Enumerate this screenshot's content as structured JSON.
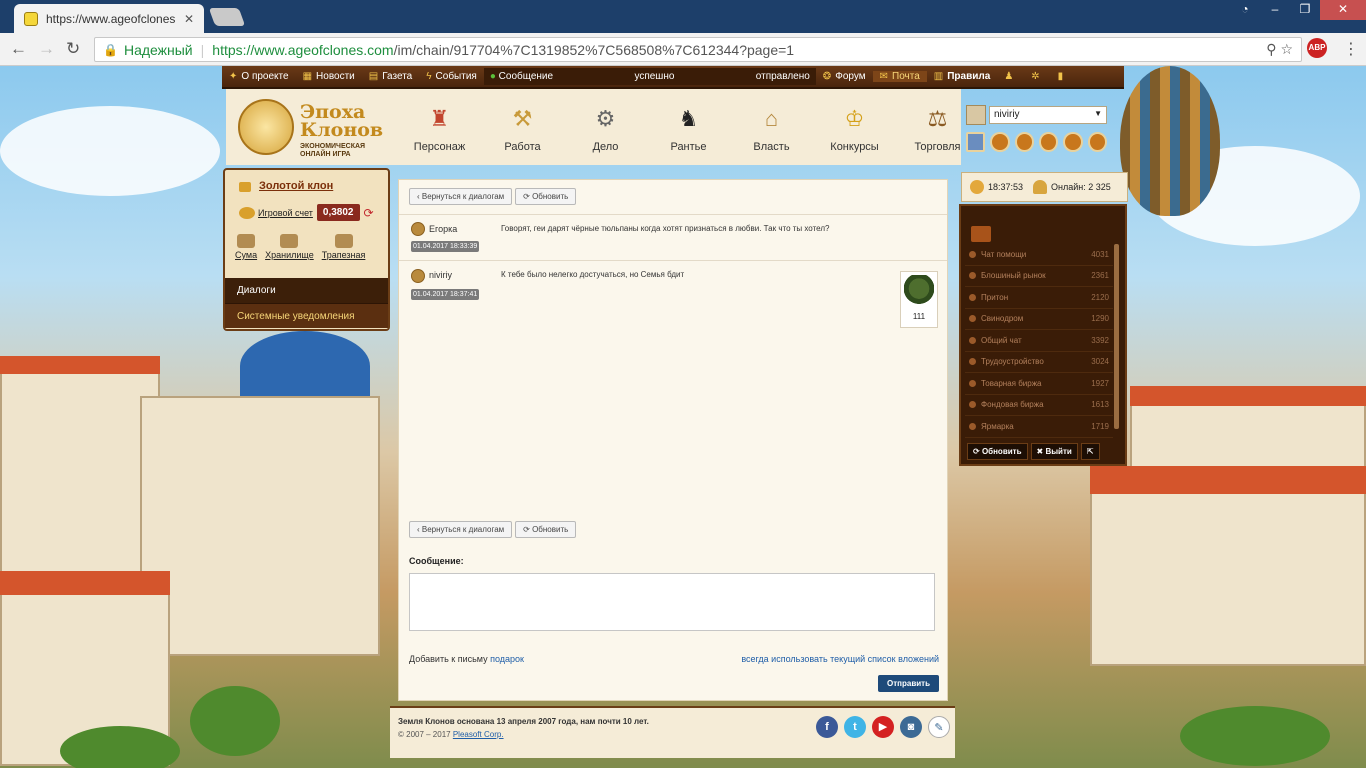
{
  "browser": {
    "tab_title": "https://www.ageofclones",
    "tab_close": "✕",
    "secure_label": "Надежный",
    "url_host": "https://www.ageofclones.com",
    "url_path": "/im/chain/917704%7C1319852%7C568508%7C612344?page=1",
    "abp": "ABP"
  },
  "gamebar": {
    "items": [
      {
        "label": "О проекте",
        "icon": "leaf-icon"
      },
      {
        "label": "Новости",
        "icon": "news-icon"
      },
      {
        "label": "Газета",
        "icon": "newspaper-icon"
      },
      {
        "label": "События",
        "icon": "bolt-icon"
      }
    ],
    "message_label": "Сообщение",
    "message_status1": "успешно",
    "message_status2": "отправлено",
    "forum": "Форум",
    "mail": "Почта",
    "rules": "Правила"
  },
  "logo": {
    "title1": "Эпоха",
    "title2": "Клонов",
    "subtitle": "ЭКОНОМИЧЕСКАЯ ОНЛАЙН ИГРА"
  },
  "mainnav": [
    {
      "label": "Персонаж",
      "icon": "character-icon"
    },
    {
      "label": "Работа",
      "icon": "work-icon"
    },
    {
      "label": "Дело",
      "icon": "business-icon"
    },
    {
      "label": "Рантье",
      "icon": "rentier-icon"
    },
    {
      "label": "Власть",
      "icon": "power-icon"
    },
    {
      "label": "Конкурсы",
      "icon": "trophy-icon"
    },
    {
      "label": "Торговля",
      "icon": "trade-icon"
    }
  ],
  "user": {
    "name": "niviriy"
  },
  "leftsidebar": {
    "gold_clone": "Золотой клон",
    "account_label": "Игровой счет",
    "account_value": "0,3802",
    "icons": [
      {
        "label": "Сума"
      },
      {
        "label": "Хранилище"
      },
      {
        "label": "Трапезная"
      }
    ],
    "menu": [
      {
        "label": "Диалоги"
      },
      {
        "label": "Системные уведомления"
      }
    ]
  },
  "content": {
    "back_button": "Вернуться к диалогам",
    "refresh_button": "Обновить",
    "messages": [
      {
        "author": "Егорка",
        "date": "01.04.2017 18:33:39",
        "text": "Говорят, геи дарят чёрные тюльпаны когда хотят признаться в любви. Так что ты хотел?"
      },
      {
        "author": "niviriy",
        "date": "01.04.2017 18:37:41",
        "text": "К тебе было нелегко достучаться, но Семья бдит"
      }
    ],
    "gift_count": "111",
    "message_label": "Сообщение:",
    "add_to_letter": "Добавить к письму",
    "gift_link": "подарок",
    "attachments_link": "всегда использовать текущий список вложений",
    "send_button": "Отправить"
  },
  "footer": {
    "line1": "Земля Клонов основана 13 апреля 2007 года, нам почти 10 лет.",
    "copyright": "© 2007 – 2017",
    "corp": "Pleasoft Corp."
  },
  "rightpanel": {
    "time": "18:37:53",
    "online_label": "Онлайн: 2 325",
    "chats": [
      {
        "name": "Чат помощи",
        "count": "4031"
      },
      {
        "name": "Блошиный рынок",
        "count": "2361"
      },
      {
        "name": "Притон",
        "count": "2120"
      },
      {
        "name": "Свинодром",
        "count": "1290"
      },
      {
        "name": "Общий чат",
        "count": "3392"
      },
      {
        "name": "Трудоустройство",
        "count": "3024"
      },
      {
        "name": "Товарная биржа",
        "count": "1927"
      },
      {
        "name": "Фондовая биржа",
        "count": "1613"
      },
      {
        "name": "Ярмарка",
        "count": "1719"
      }
    ],
    "refresh": "Обновить",
    "exit": "Выйти"
  }
}
